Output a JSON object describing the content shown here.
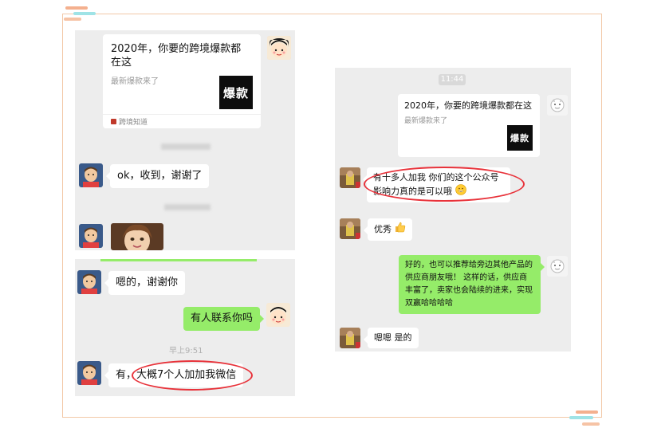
{
  "left_top": {
    "card": {
      "title": "2020年，你要的跨境爆款都在这",
      "subtitle": "最新爆款来了",
      "thumb_text": "爆款",
      "source": "跨境知道"
    },
    "message_ok": "ok，收到，谢谢了"
  },
  "left_bottom": {
    "message_1": "嗯的，谢谢你",
    "message_2": "有人联系你吗",
    "timestamp": "早上9:51",
    "message_3_prefix": "有，",
    "message_3_highlight": "大概7个人加加我微信"
  },
  "right": {
    "time": "11:44",
    "card": {
      "title": "2020年，你要的跨境爆款都在这",
      "subtitle": "最新爆款来了",
      "thumb_text": "爆款"
    },
    "message_1": "有十多人加我 你们的这个公众号影响力真的是可以哦",
    "message_2": "优秀",
    "message_3": "好的，也可以推荐给旁边其他产品的供应商朋友哦！ 这样的话，供应商丰富了，卖家也会陆续的进来，实现双赢哈哈哈哈",
    "message_4": "嗯嗯 是的"
  },
  "colors": {
    "accent_orange": "#f4a582",
    "accent_teal": "#8fe0e3",
    "chat_bg": "#ededed",
    "green_bubble": "#95ec69",
    "highlight_ring": "#e8323a"
  }
}
